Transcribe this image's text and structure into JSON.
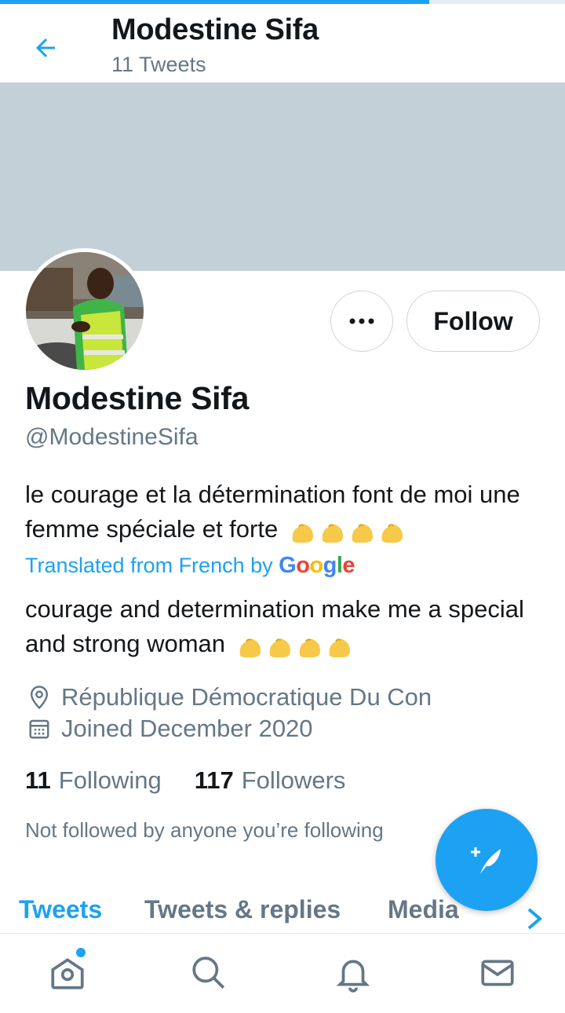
{
  "header": {
    "title": "Modestine Sifa",
    "tweet_count": "11 Tweets"
  },
  "profile": {
    "name": "Modestine Sifa",
    "handle": "@ModestineSifa",
    "bio_original": "le courage et la détermination font de moi une femme spéciale et forte",
    "translated_label": "Translated from French by",
    "translator": "Google",
    "bio_translated": "courage and determination make me a special and strong woman",
    "location": "République Démocratique Du Con",
    "joined": "Joined December 2020",
    "following_count": "11",
    "following_label": "Following",
    "followers_count": "117",
    "followers_label": "Followers",
    "not_followed": "Not followed by anyone you’re following"
  },
  "actions": {
    "follow_label": "Follow",
    "more_icon": "more-dots-icon"
  },
  "tabs": [
    {
      "label": "Tweets",
      "active": true
    },
    {
      "label": "Tweets & replies",
      "active": false
    },
    {
      "label": "Media",
      "active": false
    }
  ],
  "bottom_nav": [
    "home-icon",
    "search-icon",
    "bell-icon",
    "mail-icon"
  ],
  "colors": {
    "accent": "#1da1f2",
    "banner": "#c4d0d8",
    "muted": "#657786",
    "text": "#14171a"
  }
}
